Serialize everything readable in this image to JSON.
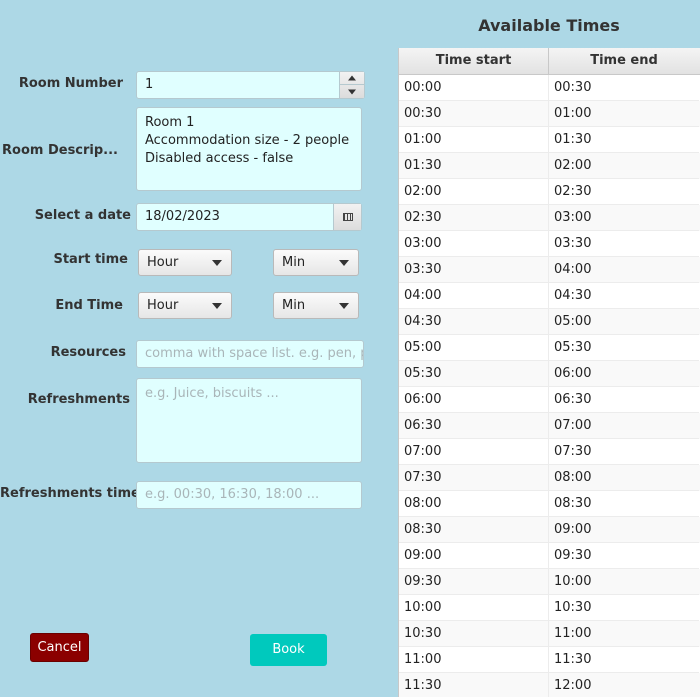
{
  "form": {
    "room_number": {
      "label": "Room Number",
      "value": "1"
    },
    "room_description": {
      "label": "Room Descrip...",
      "lines": [
        "Room 1",
        "Accommodation size - 2 people",
        "Disabled access - false"
      ]
    },
    "date": {
      "label": "Select a date",
      "value": "18/02/2023"
    },
    "start_time": {
      "label": "Start time",
      "hour": "Hour",
      "min": "Min"
    },
    "end_time": {
      "label": "End Time",
      "hour": "Hour",
      "min": "Min"
    },
    "resources": {
      "label": "Resources",
      "placeholder": "comma with space list. e.g. pen, pe"
    },
    "refreshments": {
      "label": "Refreshments",
      "placeholder": "e.g. Juice, biscuits ..."
    },
    "refreshments_time": {
      "label": "Refreshments time",
      "placeholder": "e.g. 00:30, 16:30, 18:00 ..."
    },
    "cancel_label": "Cancel",
    "book_label": "Book"
  },
  "times": {
    "title": "Available Times",
    "columns": [
      "Time start",
      "Time end"
    ],
    "rows": [
      [
        "00:00",
        "00:30"
      ],
      [
        "00:30",
        "01:00"
      ],
      [
        "01:00",
        "01:30"
      ],
      [
        "01:30",
        "02:00"
      ],
      [
        "02:00",
        "02:30"
      ],
      [
        "02:30",
        "03:00"
      ],
      [
        "03:00",
        "03:30"
      ],
      [
        "03:30",
        "04:00"
      ],
      [
        "04:00",
        "04:30"
      ],
      [
        "04:30",
        "05:00"
      ],
      [
        "05:00",
        "05:30"
      ],
      [
        "05:30",
        "06:00"
      ],
      [
        "06:00",
        "06:30"
      ],
      [
        "06:30",
        "07:00"
      ],
      [
        "07:00",
        "07:30"
      ],
      [
        "07:30",
        "08:00"
      ],
      [
        "08:00",
        "08:30"
      ],
      [
        "08:30",
        "09:00"
      ],
      [
        "09:00",
        "09:30"
      ],
      [
        "09:30",
        "10:00"
      ],
      [
        "10:00",
        "10:30"
      ],
      [
        "10:30",
        "11:00"
      ],
      [
        "11:00",
        "11:30"
      ],
      [
        "11:30",
        "12:00"
      ]
    ]
  },
  "colors": {
    "background": "#add8e6",
    "field": "#e0ffff",
    "cancel": "#8b0000",
    "book": "#00c9bd"
  }
}
